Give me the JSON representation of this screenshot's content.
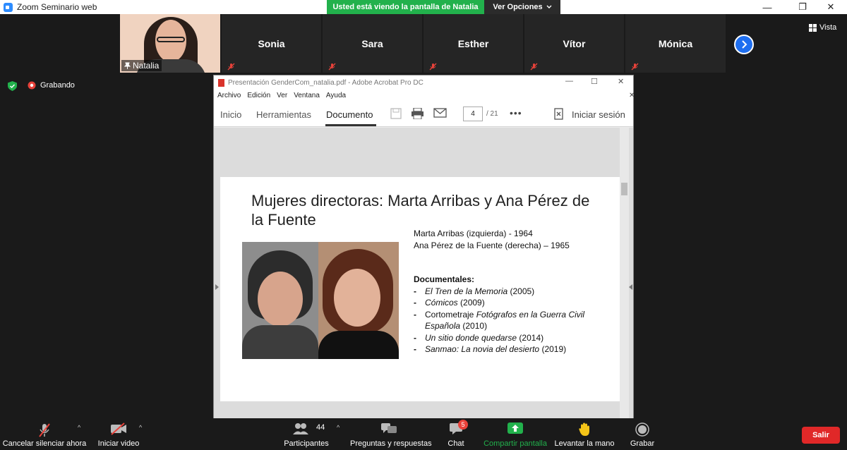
{
  "window": {
    "title": "Zoom Seminario web",
    "minimize": "—",
    "maximize": "❐",
    "close": "✕"
  },
  "share_banner": {
    "text": "Usted está viendo la pantalla de Natalia",
    "options_label": "Ver Opciones"
  },
  "participants_strip": {
    "video_name": "Natalia",
    "tiles": [
      {
        "name": "Sonia"
      },
      {
        "name": "Sara"
      },
      {
        "name": "Esther"
      },
      {
        "name": "Vítor"
      },
      {
        "name": "Mónica"
      }
    ]
  },
  "view_button": "Vista",
  "status": {
    "recording": "Grabando"
  },
  "acrobat": {
    "title": "Presentación GenderCom_natalia.pdf - Adobe Acrobat Pro DC",
    "menu": [
      "Archivo",
      "Edición",
      "Ver",
      "Ventana",
      "Ayuda"
    ],
    "tabs": {
      "home": "Inicio",
      "tools": "Herramientas",
      "document": "Documento"
    },
    "page_current": "4",
    "page_total": "/  21",
    "more": "•••",
    "signin": "Iniciar sesión"
  },
  "slide": {
    "title": "Mujeres directoras: Marta Arribas y Ana Pérez de la Fuente",
    "line1": "Marta Arribas (izquierda) - 1964",
    "line2": "Ana Pérez de la Fuente (derecha) – 1965",
    "heading": "Documentales:",
    "items": [
      {
        "prefix": "",
        "title": "El Tren de la Memoria",
        "year": " (2005)"
      },
      {
        "prefix": "",
        "title": "Cómicos",
        "year": " (2009)"
      },
      {
        "prefix": "Cortometraje ",
        "title": "Fotógrafos en la Guerra Civil Española",
        "year": " (2010)"
      },
      {
        "prefix": "",
        "title": "Un sitio donde quedarse",
        "year": " (2014)"
      },
      {
        "prefix": "",
        "title": "Sanmao: La novia del desierto",
        "year": " (2019)"
      }
    ]
  },
  "toolbar": {
    "mute": "Cancelar silenciar ahora",
    "video": "Iniciar video",
    "participants": "Participantes",
    "participants_count": "44",
    "qa": "Preguntas y respuestas",
    "chat": "Chat",
    "chat_badge": "5",
    "share": "Compartir pantalla",
    "raise_hand": "Levantar la mano",
    "record": "Grabar",
    "leave": "Salir"
  },
  "colors": {
    "share_green": "#22b14c",
    "zoom_blue": "#2d8cff",
    "leave_red": "#e02828",
    "muted_red": "#e8423a"
  }
}
